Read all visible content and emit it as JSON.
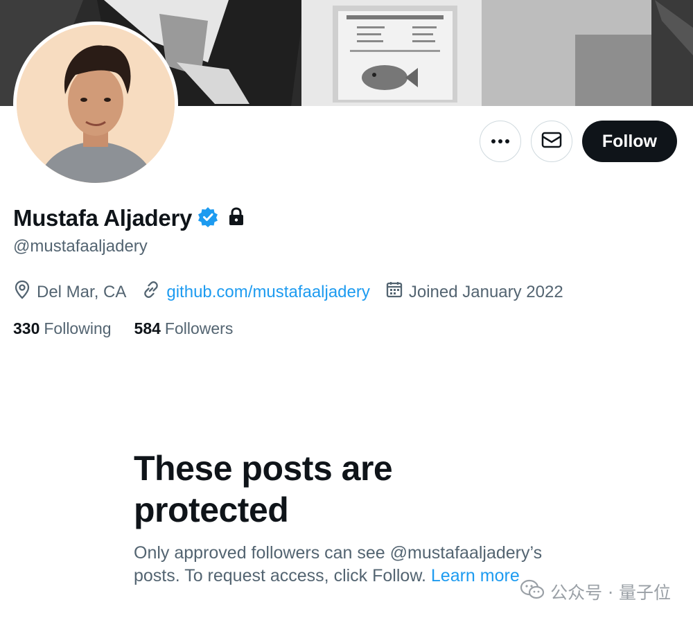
{
  "profile": {
    "display_name": "Mustafa Aljadery",
    "handle": "@mustafaaljadery",
    "location": "Del Mar, CA",
    "website": "github.com/mustafaaljadery",
    "joined": "Joined January 2022",
    "following_count": "330",
    "following_label": "Following",
    "followers_count": "584",
    "followers_label": "Followers",
    "verified": true,
    "protected": true
  },
  "actions": {
    "follow_label": "Follow"
  },
  "protected_notice": {
    "title": "These posts are protected",
    "body": "Only approved followers can see @mustafaaljadery’s posts. To request access, click Follow.",
    "link": "Learn more"
  },
  "watermark": {
    "text": "公众号 · 量子位"
  },
  "colors": {
    "accent": "#1d9bf0",
    "text_primary": "#0f1419",
    "text_secondary": "#536471",
    "border": "#cfd9de"
  },
  "icons": [
    "more-icon",
    "mail-icon",
    "verified-badge-icon",
    "lock-icon",
    "location-pin-icon",
    "link-icon",
    "calendar-icon",
    "wechat-icon"
  ]
}
